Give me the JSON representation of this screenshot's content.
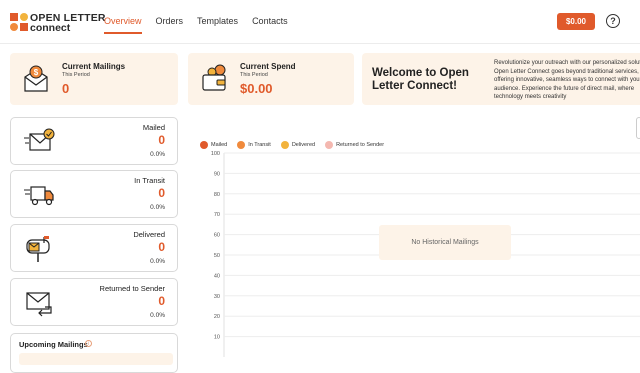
{
  "header": {
    "logo_line1": "OPEN LETTER",
    "logo_line2": "connect",
    "nav": [
      {
        "label": "Overview",
        "active": true
      },
      {
        "label": "Orders",
        "active": false
      },
      {
        "label": "Templates",
        "active": false
      },
      {
        "label": "Contacts",
        "active": false
      }
    ],
    "balance": "$0.00",
    "help_symbol": "?"
  },
  "summary": {
    "mailings": {
      "title": "Current Mailings",
      "subtitle": "This Period",
      "value": "0",
      "icon": "envelope-dollar-icon"
    },
    "spend": {
      "title": "Current Spend",
      "subtitle": "This Period",
      "value": "$0.00",
      "icon": "wallet-icon"
    },
    "welcome": {
      "title": "Welcome to Open Letter Connect!",
      "text": "Revolutionize your outreach with our personalized solutions. Open Letter Connect goes beyond traditional services, offering innovative, seamless ways to connect with your audience. Experience the future of direct mail, where technology meets creativity"
    }
  },
  "stats": [
    {
      "label": "Mailed",
      "value": "0",
      "pct": "0.0%",
      "icon": "mail-check-icon"
    },
    {
      "label": "In Transit",
      "value": "0",
      "pct": "0.0%",
      "icon": "delivery-truck-icon"
    },
    {
      "label": "Delivered",
      "value": "0",
      "pct": "0.0%",
      "icon": "mailbox-icon"
    },
    {
      "label": "Returned to Sender",
      "value": "0",
      "pct": "0.0%",
      "icon": "return-mail-icon"
    }
  ],
  "upcoming": {
    "title": "Upcoming Mailings",
    "info_symbol": "i"
  },
  "colors": {
    "accent": "#e05a2b",
    "card_bg": "#fdf3e8"
  },
  "chart_data": {
    "type": "line",
    "series": [
      {
        "name": "Mailed",
        "color": "#e05a2b",
        "values": []
      },
      {
        "name": "In Transit",
        "color": "#f08a3c",
        "values": []
      },
      {
        "name": "Delivered",
        "color": "#f2b33d",
        "values": []
      },
      {
        "name": "Returned to Sender",
        "color": "#f4b8b0",
        "values": []
      }
    ],
    "ylim": [
      0,
      100
    ],
    "yticks": [
      "100",
      "90",
      "80",
      "70",
      "60",
      "50",
      "40",
      "30",
      "20",
      "10"
    ],
    "grid": true,
    "empty_message": "No Historical Mailings"
  }
}
